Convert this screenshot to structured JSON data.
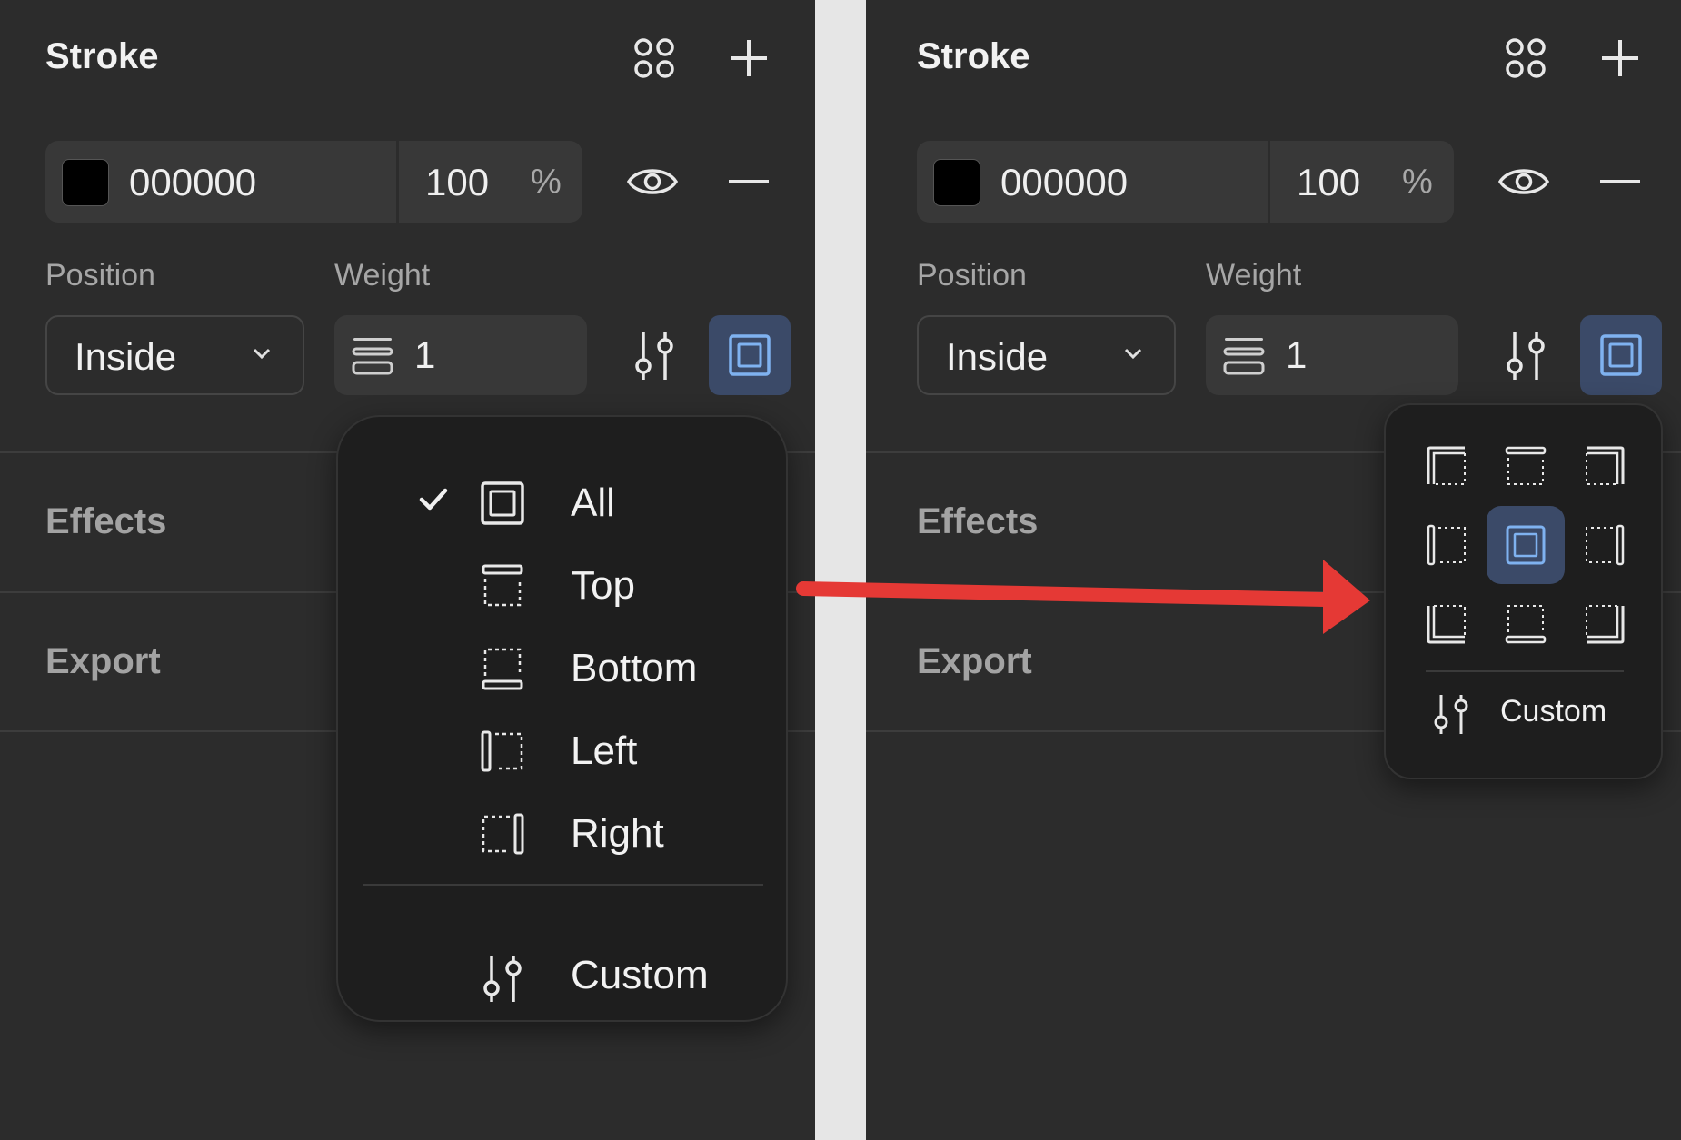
{
  "panels": {
    "left": {
      "stroke": {
        "title": "Stroke",
        "hex": "000000",
        "opacity": "100",
        "percent": "%",
        "position_label": "Position",
        "weight_label": "Weight",
        "position_value": "Inside",
        "weight_value": "1"
      },
      "sections": {
        "effects": "Effects",
        "export": "Export"
      },
      "menu": {
        "items": [
          {
            "label": "All",
            "icon": "border-all-icon",
            "checked": true
          },
          {
            "label": "Top",
            "icon": "border-top-icon"
          },
          {
            "label": "Bottom",
            "icon": "border-bottom-icon"
          },
          {
            "label": "Left",
            "icon": "border-left-icon"
          },
          {
            "label": "Right",
            "icon": "border-right-icon"
          }
        ],
        "custom": "Custom"
      }
    },
    "right": {
      "stroke": {
        "title": "Stroke",
        "hex": "000000",
        "opacity": "100",
        "percent": "%",
        "position_label": "Position",
        "weight_label": "Weight",
        "position_value": "Inside",
        "weight_value": "1"
      },
      "sections": {
        "effects": "Effects",
        "export": "Export"
      },
      "popover": {
        "grid": [
          "border-top-left-icon",
          "border-top-icon",
          "border-top-right-icon",
          "border-left-icon",
          "border-all-icon",
          "border-right-icon",
          "border-bottom-left-icon",
          "border-bottom-icon",
          "border-bottom-right-icon"
        ],
        "selected": "border-all-icon",
        "custom": "Custom"
      }
    }
  },
  "colors": {
    "panel_bg": "#2c2c2c",
    "field_bg": "#383838",
    "accent_bg": "#3b4a68",
    "accent_icon": "#7fb2f0",
    "menu_bg": "#1e1e1e",
    "arrow": "#e53935"
  }
}
